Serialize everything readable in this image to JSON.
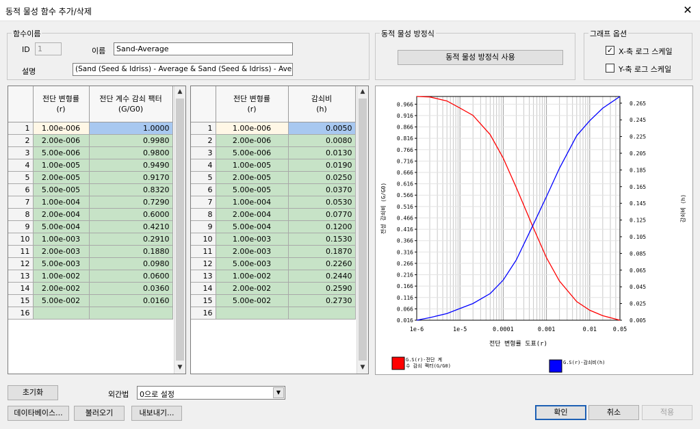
{
  "window": {
    "title": "동적 물성 함수 추가/삭제",
    "close_glyph": "✕"
  },
  "func_name_group": {
    "label": "함수이름",
    "id_label": "ID",
    "id_value": "1",
    "name_label": "이름",
    "name_value": "Sand-Average",
    "desc_label": "설명",
    "desc_value": "(Sand (Seed & Idriss) - Average & Sand (Seed & Idriss) - Average)"
  },
  "equation_group": {
    "label": "동적 물성 방정식",
    "button": "동적 물성 방정식 사용"
  },
  "graph_options": {
    "label": "그래프 옵션",
    "x_log": {
      "label": "X-축 로그 스케일",
      "checked": true
    },
    "y_log": {
      "label": "Y-축 로그 스케일",
      "checked": false
    }
  },
  "table_left": {
    "headers": [
      "전단 변형률\n(r)",
      "전단 계수 감쇠 팩터\n(G/G0)"
    ],
    "rows": [
      [
        "1",
        "1.00e-006",
        "1.0000"
      ],
      [
        "2",
        "2.00e-006",
        "0.9980"
      ],
      [
        "3",
        "5.00e-006",
        "0.9800"
      ],
      [
        "4",
        "1.00e-005",
        "0.9490"
      ],
      [
        "5",
        "2.00e-005",
        "0.9170"
      ],
      [
        "6",
        "5.00e-005",
        "0.8320"
      ],
      [
        "7",
        "1.00e-004",
        "0.7290"
      ],
      [
        "8",
        "2.00e-004",
        "0.6000"
      ],
      [
        "9",
        "5.00e-004",
        "0.4210"
      ],
      [
        "10",
        "1.00e-003",
        "0.2910"
      ],
      [
        "11",
        "2.00e-003",
        "0.1880"
      ],
      [
        "12",
        "5.00e-003",
        "0.0980"
      ],
      [
        "13",
        "1.00e-002",
        "0.0600"
      ],
      [
        "14",
        "2.00e-002",
        "0.0360"
      ],
      [
        "15",
        "5.00e-002",
        "0.0160"
      ],
      [
        "16",
        "",
        ""
      ]
    ]
  },
  "table_right": {
    "headers": [
      "전단 변형률\n(r)",
      "감쇠비\n(h)"
    ],
    "rows": [
      [
        "1",
        "1.00e-006",
        "0.0050"
      ],
      [
        "2",
        "2.00e-006",
        "0.0080"
      ],
      [
        "3",
        "5.00e-006",
        "0.0130"
      ],
      [
        "4",
        "1.00e-005",
        "0.0190"
      ],
      [
        "5",
        "2.00e-005",
        "0.0250"
      ],
      [
        "6",
        "5.00e-005",
        "0.0370"
      ],
      [
        "7",
        "1.00e-004",
        "0.0530"
      ],
      [
        "8",
        "2.00e-004",
        "0.0770"
      ],
      [
        "9",
        "5.00e-004",
        "0.1200"
      ],
      [
        "10",
        "1.00e-003",
        "0.1530"
      ],
      [
        "11",
        "2.00e-003",
        "0.1870"
      ],
      [
        "12",
        "5.00e-003",
        "0.2260"
      ],
      [
        "13",
        "1.00e-002",
        "0.2440"
      ],
      [
        "14",
        "2.00e-002",
        "0.2590"
      ],
      [
        "15",
        "5.00e-002",
        "0.2730"
      ],
      [
        "16",
        "",
        ""
      ]
    ]
  },
  "chart_data": {
    "type": "line",
    "x_scale": "log",
    "xlabel": "전단 변형률 도표(r)",
    "ylabel_left": "전성 감쇠비 (G/G0)",
    "ylabel_right": "감쇠비 (h)",
    "x_ticks": [
      "1e-6",
      "1e-5",
      "0.0001",
      "0.001",
      "0.01",
      "0.05"
    ],
    "x_tick_values": [
      1e-06,
      1e-05,
      0.0001,
      0.001,
      0.01,
      0.05
    ],
    "xlim": [
      1e-06,
      0.05
    ],
    "ylim_left": [
      0.016,
      1.0
    ],
    "ylim_right": [
      0.005,
      0.273
    ],
    "y_left_ticks": [
      "0.966",
      "0.916",
      "0.866",
      "0.816",
      "0.766",
      "0.716",
      "0.666",
      "0.616",
      "0.566",
      "0.516",
      "0.466",
      "0.416",
      "0.366",
      "0.316",
      "0.266",
      "0.216",
      "0.166",
      "0.116",
      "0.066",
      "0.016"
    ],
    "y_right_ticks": [
      "0.265",
      "0.245",
      "0.225",
      "0.205",
      "0.185",
      "0.165",
      "0.145",
      "0.125",
      "0.105",
      "0.085",
      "0.065",
      "0.045",
      "0.025",
      "0.005"
    ],
    "grid": true,
    "series": [
      {
        "name": "G.S(r)-G/G0",
        "axis": "left",
        "color": "#ff0000",
        "x": [
          1e-06,
          2e-06,
          5e-06,
          1e-05,
          2e-05,
          5e-05,
          0.0001,
          0.0002,
          0.0005,
          0.001,
          0.002,
          0.005,
          0.01,
          0.02,
          0.05
        ],
        "y": [
          1.0,
          0.998,
          0.98,
          0.949,
          0.917,
          0.832,
          0.729,
          0.6,
          0.421,
          0.291,
          0.188,
          0.098,
          0.06,
          0.036,
          0.016
        ]
      },
      {
        "name": "G.S(r)-(h)",
        "axis": "right",
        "color": "#0000ff",
        "x": [
          1e-06,
          2e-06,
          5e-06,
          1e-05,
          2e-05,
          5e-05,
          0.0001,
          0.0002,
          0.0005,
          0.001,
          0.002,
          0.005,
          0.01,
          0.02,
          0.05
        ],
        "y": [
          0.005,
          0.008,
          0.013,
          0.019,
          0.025,
          0.037,
          0.053,
          0.077,
          0.12,
          0.153,
          0.187,
          0.226,
          0.244,
          0.259,
          0.273
        ]
      }
    ],
    "legend": [
      {
        "line1": "G.S(r)-전단 계",
        "line2": "수 감쇠 팩터(G/G0)",
        "color": "#ff0000"
      },
      {
        "line1": "G.S(r)-감쇠비(h)",
        "line2": "",
        "color": "#0000ff"
      }
    ]
  },
  "bottom": {
    "reset_button": "초기화",
    "interp_label": "외간법",
    "interp_value": "0으로 설정",
    "database_button": "데이타베이스...",
    "load_button": "불러오기",
    "export_button": "내보내기...",
    "ok_button": "확인",
    "cancel_button": "취소",
    "apply_button": "적용"
  }
}
